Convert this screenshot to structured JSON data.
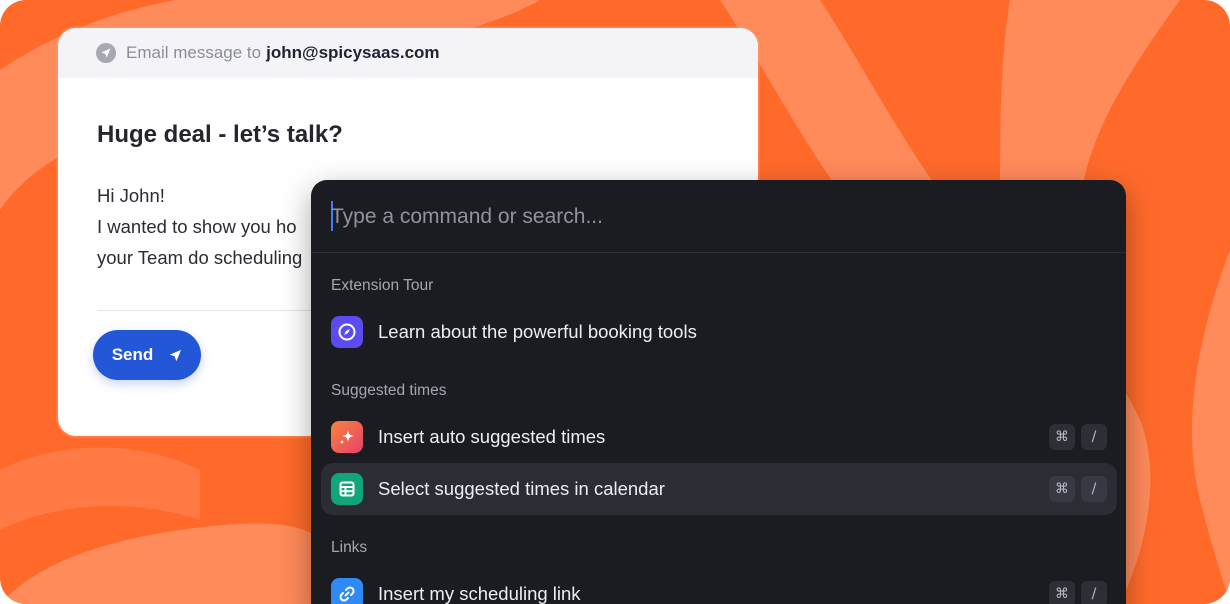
{
  "email": {
    "to_label": "Email message to",
    "to_address": "john@spicysaas.com",
    "subject": "Huge deal - let’s talk?",
    "body_lines": [
      "Hi John!",
      "I wanted to show you ho",
      "your Team do scheduling"
    ],
    "send_label": "Send"
  },
  "palette": {
    "search_placeholder": "Type a command or search...",
    "sections": [
      {
        "label": "Extension Tour",
        "items": [
          {
            "label": "Learn about the powerful booking tools",
            "icon": "compass-icon",
            "icon_color": "#5b4bf0",
            "shortcut": []
          }
        ]
      },
      {
        "label": "Suggested times",
        "items": [
          {
            "label": "Insert auto suggested times",
            "icon": "sparkle-icon",
            "icon_color": "#f2622f",
            "shortcut": [
              "⌘",
              "/"
            ]
          },
          {
            "label": "Select suggested times in calendar",
            "icon": "table-icon",
            "icon_color": "#12a57a",
            "shortcut": [
              "⌘",
              "/"
            ]
          }
        ]
      },
      {
        "label": "Links",
        "items": [
          {
            "label": "Insert my scheduling link",
            "icon": "link-icon",
            "icon_color": "#2f8af5",
            "shortcut": [
              "⌘",
              "/"
            ]
          }
        ]
      }
    ]
  },
  "colors": {
    "background": "#ff6a2b",
    "accent": "#2456d8",
    "palette_bg": "#1a1c21"
  }
}
